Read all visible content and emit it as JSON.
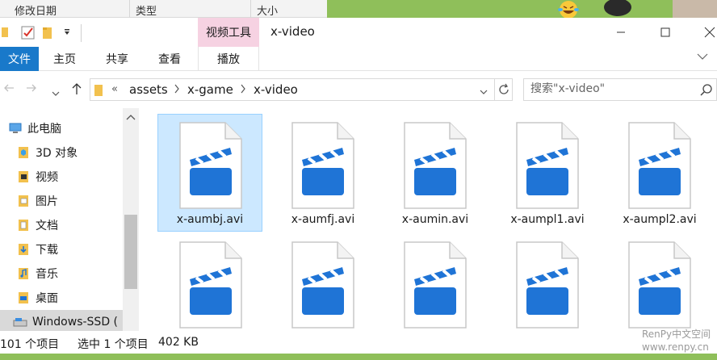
{
  "background_window": {
    "columns": [
      "修改日期",
      "类型",
      "大小"
    ]
  },
  "titlebar": {
    "context_tab": "视频工具",
    "title": "x-video"
  },
  "ribbon": {
    "tabs": [
      "文件",
      "主页",
      "共享",
      "查看",
      "播放"
    ]
  },
  "address": {
    "prefix": "«",
    "crumbs": [
      "assets",
      "x-game",
      "x-video"
    ]
  },
  "search": {
    "placeholder": "搜索\"x-video\""
  },
  "sidebar": {
    "items": [
      {
        "label": "此电脑",
        "icon": "computer-icon"
      },
      {
        "label": "3D 对象",
        "icon": "3d-objects-icon"
      },
      {
        "label": "视频",
        "icon": "video-folder-icon"
      },
      {
        "label": "图片",
        "icon": "pictures-folder-icon"
      },
      {
        "label": "文档",
        "icon": "documents-folder-icon"
      },
      {
        "label": "下载",
        "icon": "downloads-folder-icon"
      },
      {
        "label": "音乐",
        "icon": "music-folder-icon"
      },
      {
        "label": "桌面",
        "icon": "desktop-folder-icon"
      },
      {
        "label": "Windows-SSD (",
        "icon": "drive-icon"
      }
    ]
  },
  "files": [
    {
      "name": "x-aumbj.avi",
      "selected": true
    },
    {
      "name": "x-aumfj.avi",
      "selected": false
    },
    {
      "name": "x-aumin.avi",
      "selected": false
    },
    {
      "name": "x-aumpl1.avi",
      "selected": false
    },
    {
      "name": "x-aumpl2.avi",
      "selected": false
    },
    {
      "name": "",
      "selected": false
    },
    {
      "name": "",
      "selected": false
    },
    {
      "name": "",
      "selected": false
    },
    {
      "name": "",
      "selected": false
    },
    {
      "name": "",
      "selected": false
    }
  ],
  "status": {
    "count": "101 个项目",
    "selection": "选中 1 个项目",
    "size": "402 KB"
  },
  "watermark": {
    "line1": "RenPy中文空间",
    "line2": "www.renpy.cn"
  },
  "colors": {
    "accent": "#1979ca",
    "video_tools_tab": "#f6d2e2",
    "selection": "#cce8ff",
    "clapper": "#1f74d6"
  }
}
